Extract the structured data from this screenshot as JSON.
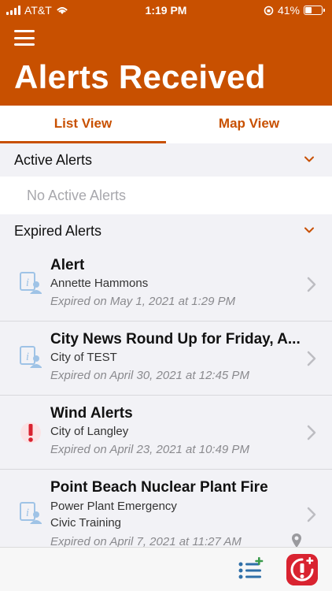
{
  "status_bar": {
    "carrier": "AT&T",
    "time": "1:19 PM",
    "battery": "41%",
    "battery_level": 0.41
  },
  "header": {
    "title": "Alerts Received"
  },
  "tabs": [
    {
      "label": "List View",
      "active": true
    },
    {
      "label": "Map View",
      "active": false
    }
  ],
  "sections": {
    "active": {
      "title": "Active Alerts",
      "empty_text": "No Active Alerts"
    },
    "expired": {
      "title": "Expired Alerts"
    }
  },
  "alerts": [
    {
      "icon": "info-person-icon",
      "title": "Alert",
      "lines": [
        "Annette Hammons"
      ],
      "expired": "Expired on May 1, 2021 at 1:29 PM"
    },
    {
      "icon": "info-person-icon",
      "title": "City News Round Up for Friday, A...",
      "lines": [
        "City of TEST"
      ],
      "expired": "Expired on April 30, 2021 at 12:45 PM"
    },
    {
      "icon": "exclamation-icon",
      "title": "Wind Alerts",
      "lines": [
        "City of Langley"
      ],
      "expired": "Expired on April 23, 2021 at 10:49 PM"
    },
    {
      "icon": "info-person-icon",
      "title": "Point Beach Nuclear Plant Fire",
      "lines": [
        "Power Plant Emergency",
        "Civic Training"
      ],
      "expired": "Expired on April 7, 2021 at 11:27 AM",
      "has_location": true
    }
  ],
  "bottom_bar": {
    "left_icon": "list-add-icon",
    "right_icon": "alert-add-icon"
  },
  "colors": {
    "brand": "#c85000",
    "alert_red": "#d92330",
    "info_blue": "#9fc3e6"
  }
}
